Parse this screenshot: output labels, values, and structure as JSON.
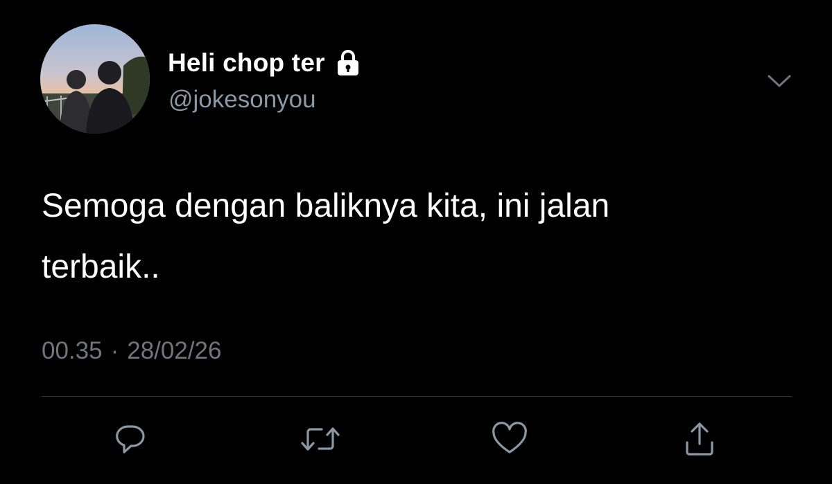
{
  "header": {
    "display_name": "Heli chop ter",
    "handle": "@jokesonyou",
    "avatar": "profile-photo-two-people-at-dusk",
    "protected_icon": "lock-icon",
    "menu_icon": "chevron-down-icon"
  },
  "tweet": {
    "text": "Semoga dengan baliknya kita, ini jalan\nterbaik..",
    "time": "00.35",
    "separator": "·",
    "date": "28/02/26"
  },
  "actions": [
    {
      "name": "reply",
      "icon": "reply-icon"
    },
    {
      "name": "retweet",
      "icon": "retweet-icon"
    },
    {
      "name": "like",
      "icon": "heart-icon"
    },
    {
      "name": "share",
      "icon": "share-icon"
    }
  ],
  "colors": {
    "background": "#000000",
    "text_primary": "#ffffff",
    "text_secondary": "#71767b",
    "icon_gray": "#8b98a5",
    "divider": "#2f3336"
  }
}
